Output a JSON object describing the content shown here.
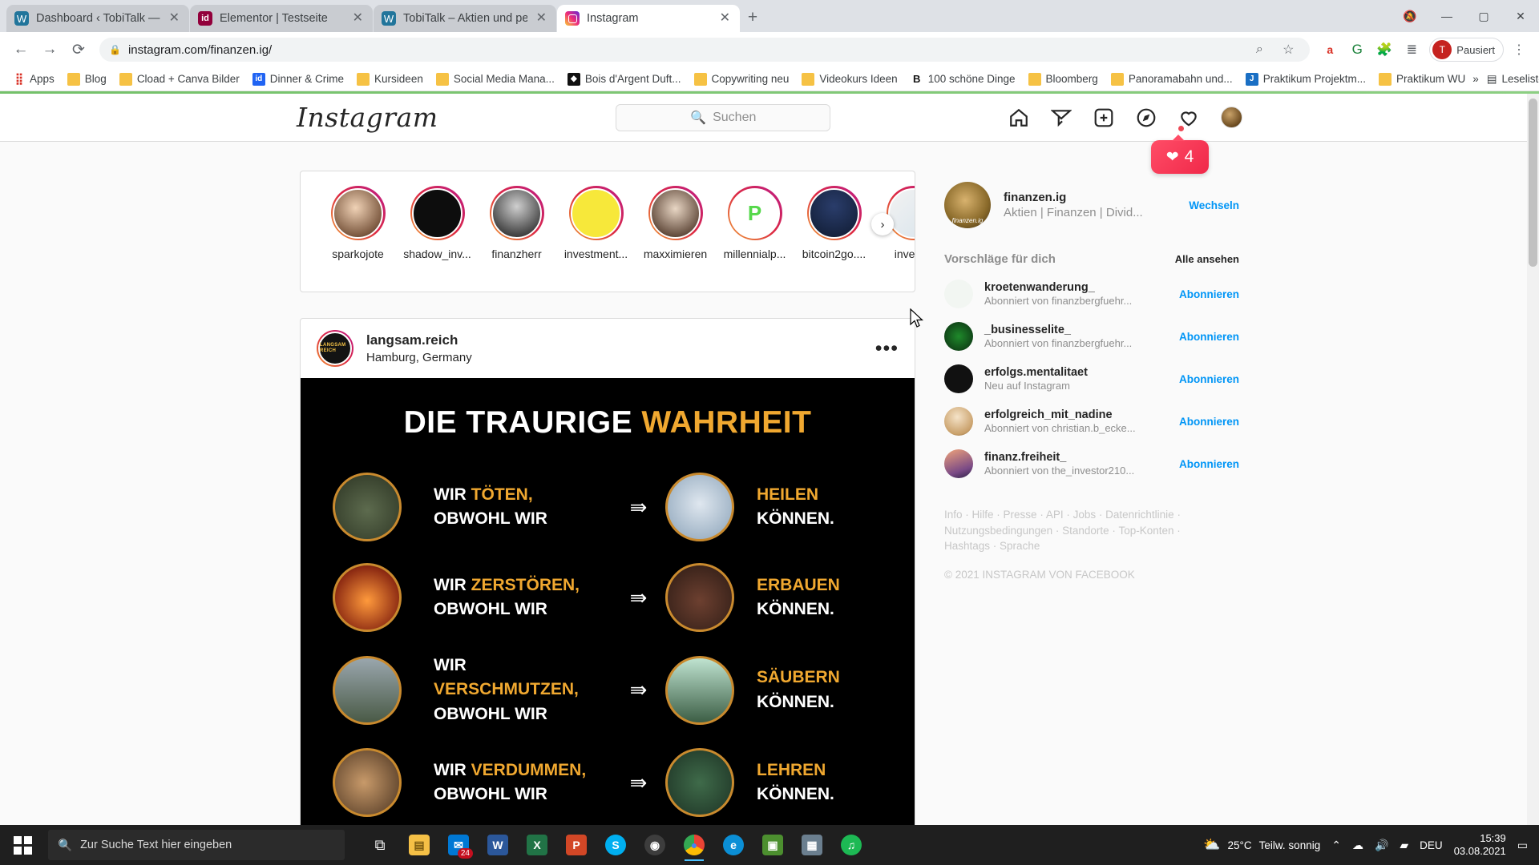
{
  "browser": {
    "tabs": [
      {
        "title": "Dashboard ‹ TobiTalk — WordPre",
        "favicon": "wordpress-icon",
        "active": false
      },
      {
        "title": "Elementor | Testseite",
        "favicon": "elementor-icon",
        "active": false
      },
      {
        "title": "TobiTalk – Aktien und persönlich",
        "favicon": "wordpress-icon",
        "active": false
      },
      {
        "title": "Instagram",
        "favicon": "instagram-icon",
        "active": true
      }
    ],
    "new_tab_label": "+",
    "window_controls": {
      "minimize": "—",
      "maximize": "▢",
      "close": "✕"
    },
    "nav": {
      "back": "←",
      "forward": "→",
      "reload": "⟳"
    },
    "omnibox": {
      "url": "instagram.com/finanzen.ig/",
      "lock": "lock-icon",
      "zoom_icon": "zoom-icon",
      "star_icon": "star-icon"
    },
    "toolbar_icons": [
      "avast-icon",
      "grammarly-icon",
      "extensions-icon",
      "list-icon"
    ],
    "profile": {
      "label": "Pausiert",
      "initial": "T"
    },
    "menu": "⋮",
    "bookmarks": [
      {
        "label": "Apps",
        "icon": "apps-grid-icon"
      },
      {
        "label": "Blog",
        "icon": "folder-icon"
      },
      {
        "label": "Cload + Canva Bilder",
        "icon": "folder-icon"
      },
      {
        "label": "Dinner & Crime",
        "icon": "indeed-icon"
      },
      {
        "label": "Kursideen",
        "icon": "folder-icon"
      },
      {
        "label": "Social Media Mana...",
        "icon": "folder-icon"
      },
      {
        "label": "Bois d'Argent Duft...",
        "icon": "site-icon-dark"
      },
      {
        "label": "Copywriting neu",
        "icon": "folder-icon"
      },
      {
        "label": "Videokurs Ideen",
        "icon": "folder-icon"
      },
      {
        "label": "100 schöne Dinge",
        "icon": "bloomberg-icon"
      },
      {
        "label": "Bloomberg",
        "icon": "folder-icon"
      },
      {
        "label": "Panoramabahn und...",
        "icon": "folder-icon"
      },
      {
        "label": "Praktikum Projektm...",
        "icon": "blue-doc-icon"
      },
      {
        "label": "Praktikum WU",
        "icon": "folder-icon"
      }
    ],
    "bookmarks_overflow": "»",
    "reading_list": {
      "label": "Leseliste",
      "icon": "reading-list-icon"
    }
  },
  "instagram": {
    "logo": "Instagram",
    "search_placeholder": "Suchen",
    "nav_icons": [
      "home-icon",
      "direct-icon",
      "new-post-icon",
      "explore-icon",
      "activity-icon"
    ],
    "notification": {
      "count": "4",
      "icon": "heart-icon"
    },
    "stories": [
      {
        "name": "sparkojote"
      },
      {
        "name": "shadow_inv..."
      },
      {
        "name": "finanzherr"
      },
      {
        "name": "investment..."
      },
      {
        "name": "maxximieren"
      },
      {
        "name": "millennialp..."
      },
      {
        "name": "bitcoin2go...."
      },
      {
        "name": "investie"
      }
    ],
    "stories_next": "›",
    "post": {
      "username": "langsam.reich",
      "location": "Hamburg, Germany",
      "avatar_text": "LANGSAM REICH",
      "more": "•••",
      "meme": {
        "title_plain": "DIE TRAURIGE ",
        "title_highlight": "WAHRHEIT",
        "rows": [
          {
            "left_hl": "TÖTEN,",
            "left_pre": "WIR ",
            "left_post": "OBWOHL WIR",
            "arrow": "⇛",
            "right_hl": "HEILEN",
            "right_post": "KÖNNEN."
          },
          {
            "left_hl": "ZERSTÖREN,",
            "left_pre": "WIR ",
            "left_post": "OBWOHL WIR",
            "arrow": "⇛",
            "right_hl": "ERBAUEN",
            "right_post": "KÖNNEN."
          },
          {
            "left_hl": "VERSCHMUTZEN,",
            "left_pre": "WIR ",
            "left_post": "OBWOHL WIR",
            "arrow": "⇛",
            "right_hl": "SÄUBERN",
            "right_post": "KÖNNEN."
          },
          {
            "left_hl": "VERDUMMEN,",
            "left_pre": "WIR ",
            "left_post": "OBWOHL WIR",
            "arrow": "⇛",
            "right_hl": "LEHREN",
            "right_post": "KÖNNEN."
          }
        ]
      }
    },
    "sidebar": {
      "me": {
        "username": "finanzen.ig",
        "subtitle": "Aktien | Finanzen | Divid...",
        "switch_label": "Wechseln",
        "avatar_caption": "finanzen.ig"
      },
      "suggestions_title": "Vorschläge für dich",
      "see_all": "Alle ansehen",
      "suggestions": [
        {
          "username": "kroetenwanderung_",
          "subtitle": "Abonniert von finanzbergfuehr...",
          "action": "Abonnieren"
        },
        {
          "username": "_businesselite_",
          "subtitle": "Abonniert von finanzbergfuehr...",
          "action": "Abonnieren"
        },
        {
          "username": "erfolgs.mentalitaet",
          "subtitle": "Neu auf Instagram",
          "action": "Abonnieren"
        },
        {
          "username": "erfolgreich_mit_nadine",
          "subtitle": "Abonniert von christian.b_ecke...",
          "action": "Abonnieren"
        },
        {
          "username": "finanz.freiheit_",
          "subtitle": "Abonniert von the_investor210...",
          "action": "Abonnieren"
        }
      ],
      "footer_links": [
        "Info",
        "Hilfe",
        "Presse",
        "API",
        "Jobs",
        "Datenrichtlinie",
        "Nutzungsbedingungen",
        "Standorte",
        "Top-Konten",
        "Hashtags",
        "Sprache"
      ],
      "copyright": "© 2021 INSTAGRAM VON FACEBOOK"
    }
  },
  "taskbar": {
    "search_placeholder": "Zur Suche Text hier eingeben",
    "search_icon": "search-icon",
    "start_icon": "windows-icon",
    "task_view_icon": "task-view-icon",
    "apps": [
      {
        "name": "file-explorer",
        "glyph": "📁",
        "color": "#f5c046"
      },
      {
        "name": "mail",
        "glyph": "✉",
        "color": "#0078d4",
        "badge": "24"
      },
      {
        "name": "word",
        "glyph": "W",
        "color": "#2b579a"
      },
      {
        "name": "excel",
        "glyph": "X",
        "color": "#217346"
      },
      {
        "name": "powerpoint",
        "glyph": "P",
        "color": "#d24726"
      },
      {
        "name": "skype",
        "glyph": "S",
        "color": "#00aff0"
      },
      {
        "name": "obs",
        "glyph": "◉",
        "color": "#3d3d3d"
      },
      {
        "name": "chrome",
        "glyph": "◎",
        "color": "#4285f4"
      },
      {
        "name": "edge",
        "glyph": "e",
        "color": "#0078d7"
      },
      {
        "name": "camtasia",
        "glyph": "▣",
        "color": "#4c8f2f"
      },
      {
        "name": "photos",
        "glyph": "🖼",
        "color": "#6b7f8f"
      },
      {
        "name": "spotify",
        "glyph": "♫",
        "color": "#1db954"
      }
    ],
    "weather": {
      "temp": "25°C",
      "desc": "Teilw. sonnig",
      "icon": "partly-sunny-icon"
    },
    "tray_icons": [
      "chevron-up-icon",
      "onedrive-icon",
      "volume-icon",
      "network-icon"
    ],
    "language": "DEU",
    "clock": {
      "time": "15:39",
      "date": "03.08.2021"
    },
    "notification_icon": "notification-icon"
  }
}
